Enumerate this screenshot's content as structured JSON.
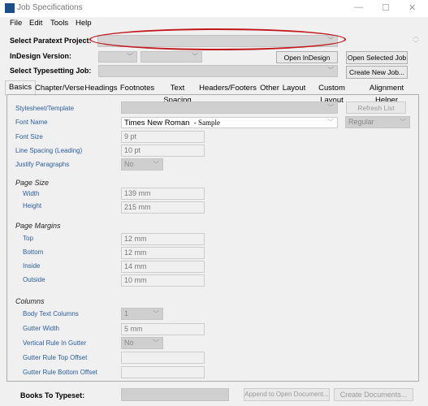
{
  "window": {
    "title": "Job Specifications",
    "minimize": "—",
    "maximize": "☐",
    "close": "✕"
  },
  "menu": [
    "File",
    "Edit",
    "Tools",
    "Help"
  ],
  "header": {
    "paratext_label": "Select Paratext Project:",
    "indesign_label": "InDesign Version:",
    "job_label": "Select Typesetting Job:",
    "open_indesign": "Open InDesign",
    "open_selected_job": "Open Selected Job",
    "create_new_job": "Create New Job...",
    "annotation_color": "#c0181c"
  },
  "tabs": [
    "Basics",
    "Chapter/Verse",
    "Headings",
    "Footnotes",
    "Text Spacing",
    "Headers/Footers",
    "Other",
    "Layout",
    "Custom Layout",
    "Alignment Helper"
  ],
  "basics": {
    "stylesheet_label": "Stylesheet/Template",
    "refresh_list": "Refresh List",
    "font_name_label": "Font Name",
    "font_name": "Times New Roman",
    "font_sample": "- Sample",
    "font_style": "Regular",
    "font_size_label": "Font Size",
    "font_size": "9 pt",
    "line_spacing_label": "Line Spacing (Leading)",
    "line_spacing": "10 pt",
    "justify_label": "Justify Paragraphs",
    "justify": "No",
    "page_size": "Page Size",
    "width_label": "Width",
    "width": "139 mm",
    "height_label": "Height",
    "height": "215 mm",
    "page_margins": "Page Margins",
    "top_label": "Top",
    "top": "12 mm",
    "bottom_label": "Bottom",
    "bottom": "12 mm",
    "inside_label": "Inside",
    "inside": "14 mm",
    "outside_label": "Outside",
    "outside": "10 mm",
    "columns": "Columns",
    "body_cols_label": "Body Text Columns",
    "body_cols": "1",
    "gutter_width_label": "Gutter Width",
    "gutter_width": "5 mm",
    "vrule_label": "Vertical Rule In Gutter",
    "vrule": "No",
    "rule_top_label": "Gutter Rule Top Offset",
    "rule_top": "",
    "rule_bottom_label": "Gutter Rule Bottom Offset",
    "rule_bottom": ""
  },
  "footer": {
    "books_label": "Books To Typeset:",
    "append": "Append to Open Document...",
    "create_docs": "Create Documents..."
  }
}
